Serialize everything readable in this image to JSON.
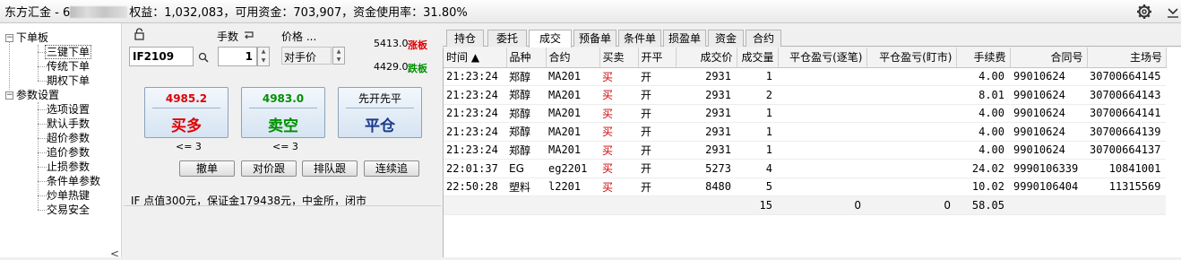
{
  "window": {
    "title_prefix": "东方汇金 - 6",
    "title_suffix": "权益：1,032,083，可用资金：703,907，资金使用率：31.80%"
  },
  "tree": {
    "groups": [
      {
        "label": "下单板",
        "children": [
          "三键下单",
          "传统下单",
          "期权下单"
        ]
      },
      {
        "label": "参数设置",
        "children": [
          "选项设置",
          "默认手数",
          "超价参数",
          "追价参数",
          "止损参数",
          "条件单参数",
          "炒单热键",
          "交易安全"
        ]
      }
    ],
    "selected": "三键下单",
    "scroll_left": "<"
  },
  "order": {
    "qty_label": "手数",
    "price_label": "价格 ...",
    "contract": "IF2109",
    "qty": "1",
    "price_mode": "对手价",
    "limit_up": "5413.0",
    "limit_up_label": "涨板",
    "limit_down": "4429.0",
    "limit_down_label": "跌板",
    "buy": {
      "price": "4985.2",
      "label": "买多",
      "limit": "<= 3"
    },
    "sell": {
      "price": "4983.0",
      "label": "卖空",
      "limit": "<= 3"
    },
    "close": {
      "price": "先开先平",
      "label": "平仓"
    },
    "buttons": [
      "撤单",
      "对价跟",
      "排队跟",
      "连续追"
    ],
    "info": "IF 点值300元，保证金179438元，中金所，闭市",
    "colors": {
      "red": "#e00000",
      "green": "#009000",
      "blue": "#1a3a8a"
    }
  },
  "tabs": [
    "持仓",
    "委托",
    "成交",
    "预备单",
    "条件单",
    "损盈单",
    "资金",
    "合约"
  ],
  "active_tab": "成交",
  "grid": {
    "columns": [
      "时间 ▲",
      "品种",
      "合约",
      "买卖",
      "开平",
      "成交价",
      "成交量",
      "平仓盈亏(逐笔)",
      "平仓盈亏(盯市)",
      "手续费",
      "合同号",
      "主场号"
    ],
    "rows": [
      [
        "21:23:24",
        "郑醇",
        "MA201",
        "买",
        "开",
        "2931",
        "1",
        "",
        "",
        "4.00",
        "99010624",
        "30700664145"
      ],
      [
        "21:23:24",
        "郑醇",
        "MA201",
        "买",
        "开",
        "2931",
        "2",
        "",
        "",
        "8.01",
        "99010624",
        "30700664143"
      ],
      [
        "21:23:24",
        "郑醇",
        "MA201",
        "买",
        "开",
        "2931",
        "1",
        "",
        "",
        "4.00",
        "99010624",
        "30700664141"
      ],
      [
        "21:23:24",
        "郑醇",
        "MA201",
        "买",
        "开",
        "2931",
        "1",
        "",
        "",
        "4.00",
        "99010624",
        "30700664139"
      ],
      [
        "21:23:24",
        "郑醇",
        "MA201",
        "买",
        "开",
        "2931",
        "1",
        "",
        "",
        "4.00",
        "99010624",
        "30700664137"
      ],
      [
        "22:01:37",
        "EG",
        "eg2201",
        "买",
        "开",
        "5273",
        "4",
        "",
        "",
        "24.02",
        "9990106339",
        "10841001"
      ],
      [
        "22:50:28",
        "塑料",
        "l2201",
        "买",
        "开",
        "8480",
        "5",
        "",
        "",
        "10.02",
        "9990106404",
        "11315569"
      ]
    ],
    "summary": [
      "",
      "",
      "",
      "",
      "",
      "",
      "15",
      "0",
      "0",
      "58.05",
      "",
      ""
    ]
  },
  "icons": {
    "lock": "lock-icon",
    "gear": "gear-icon",
    "collapse": "chevron-down-icon",
    "search": "search-icon",
    "refresh": "return-icon"
  }
}
